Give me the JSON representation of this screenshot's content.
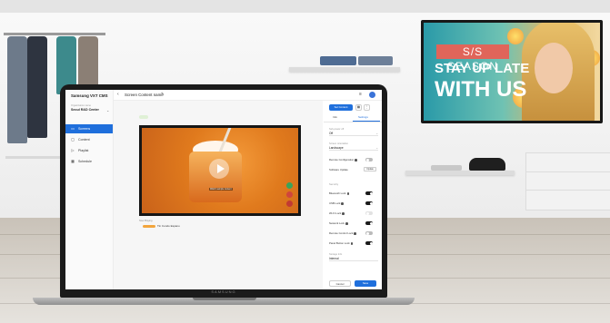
{
  "app": {
    "title": "Samsung VXT CMS",
    "organization_label": "Organization name",
    "organization": "Seoul R&D Center",
    "brand": "SAMSUNG"
  },
  "nav": [
    {
      "label": "Screens",
      "icon": "screen-icon",
      "active": true
    },
    {
      "label": "Content",
      "icon": "content-icon",
      "active": false
    },
    {
      "label": "Playlist",
      "icon": "playlist-icon",
      "active": false
    },
    {
      "label": "Schedule",
      "icon": "schedule-icon",
      "active": false
    }
  ],
  "header": {
    "page_title": "Screen Content name"
  },
  "player": {
    "caption": "Watch sample content",
    "now_playing_label": "Now Playing",
    "now_playing_item": "Tin Condo Espano"
  },
  "panel": {
    "primary_button": "Set Content",
    "tabs": [
      "Info",
      "Settings"
    ],
    "active_tab": "Settings",
    "fields": [
      {
        "label": "Sub-power off",
        "value": "Off"
      },
      {
        "label": "Screen orientation",
        "value": "Landscape"
      }
    ],
    "remote_configuration": {
      "label": "Remote Configuration",
      "on": false
    },
    "software_update": {
      "label": "Software Update",
      "button": "Update"
    },
    "security_header": "Security",
    "toggles": [
      {
        "label": "Bluetooth Lock",
        "on": false
      },
      {
        "label": "USB Lock",
        "on": false
      },
      {
        "label": "Wi-Fi Lock",
        "on": false
      },
      {
        "label": "Network Lock",
        "on": false
      },
      {
        "label": "Remote Control Lock",
        "on": false
      },
      {
        "label": "Panel Button Lock",
        "on": false
      }
    ],
    "storage_label": "Storage Info",
    "storage_value": "Internal",
    "cancel_button": "Cancel",
    "save_button": "Save"
  },
  "tv": {
    "badge": "S/S SEASON",
    "line1": "STAY UP LATE",
    "line2": "WITH US"
  },
  "colors": {
    "accent": "#1f6fdc",
    "badge": "#e0655a"
  }
}
